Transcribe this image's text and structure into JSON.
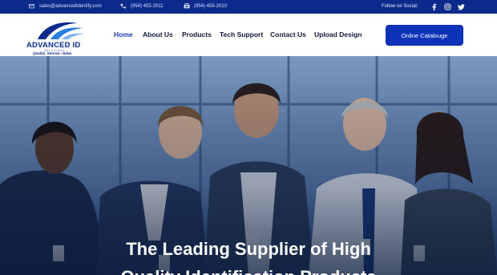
{
  "topbar": {
    "email": "sales@advancedidentify.com",
    "phone": "(954) 455-2011",
    "fax": "(954) 455-2010",
    "social_label": "Follow on Social:",
    "social_icons": [
      "facebook-icon",
      "instagram-icon",
      "twitter-icon"
    ]
  },
  "logo": {
    "title": "ADVANCED ID",
    "subtitle": "SOLUTIONS",
    "tagline": "Quality. Service. Value."
  },
  "nav": {
    "items": [
      {
        "label": "Home",
        "active": true
      },
      {
        "label": "About Us",
        "active": false
      },
      {
        "label": "Products",
        "active": false
      },
      {
        "label": "Tech Support",
        "active": false
      },
      {
        "label": "Contact Us",
        "active": false
      },
      {
        "label": "Upload Design",
        "active": false
      }
    ],
    "cta_label": "Online Catalouge"
  },
  "hero": {
    "title_line1": "The Leading Supplier of High",
    "title_line2": "Quality Identification Products"
  },
  "colors": {
    "brand_blue": "#0b2a8c",
    "cta_blue": "#0e33b8",
    "nav_active": "#1a3fb0"
  }
}
